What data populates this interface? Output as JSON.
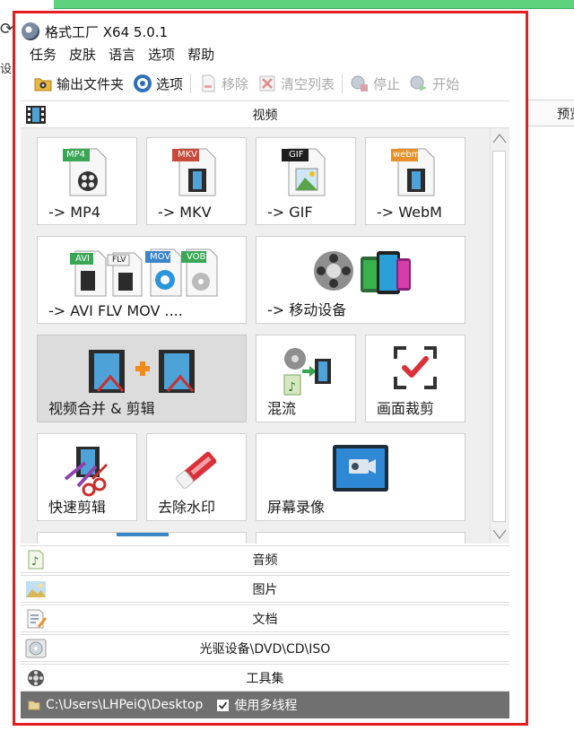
{
  "window": {
    "title": "格式工厂 X64 5.0.1"
  },
  "menu": [
    "任务",
    "皮肤",
    "语言",
    "选项",
    "帮助"
  ],
  "toolbar": {
    "output_folder": "输出文件夹",
    "options": "选项",
    "remove": "移除",
    "clear_list": "清空列表",
    "stop": "停止",
    "start": "开始"
  },
  "background": {
    "side_text": "设",
    "right_tab": "预览"
  },
  "categories": {
    "video": "视频",
    "audio": "音频",
    "image": "图片",
    "document": "文档",
    "disc": "光驱设备\\DVD\\CD\\ISO",
    "tools": "工具集"
  },
  "video_tiles": [
    {
      "label": "-> MP4",
      "badge": "MP4"
    },
    {
      "label": "-> MKV",
      "badge": "MKV"
    },
    {
      "label": "-> GIF",
      "badge": "GIF"
    },
    {
      "label": "-> WebM",
      "badge": "webm"
    },
    {
      "label": "-> AVI FLV MOV ....",
      "badges": [
        "AVI",
        "FLV",
        "MOV",
        "VOB"
      ]
    },
    {
      "label": "-> 移动设备"
    },
    {
      "label": "视频合并 & 剪辑"
    },
    {
      "label": "混流"
    },
    {
      "label": "画面裁剪"
    },
    {
      "label": "快速剪辑"
    },
    {
      "label": "去除水印"
    },
    {
      "label": "屏幕录像"
    }
  ],
  "status": {
    "path": "C:\\Users\\LHPeiQ\\Desktop",
    "multithread_label": "使用多线程",
    "multithread_checked": true
  },
  "colors": {
    "frame_red": "#e41e1e",
    "status_bg": "#707070",
    "badge_green": "#3aa655",
    "badge_red": "#c94a3a",
    "badge_black": "#1e1e1e",
    "badge_orange": "#e8912a",
    "badge_blue": "#3b86c9"
  }
}
